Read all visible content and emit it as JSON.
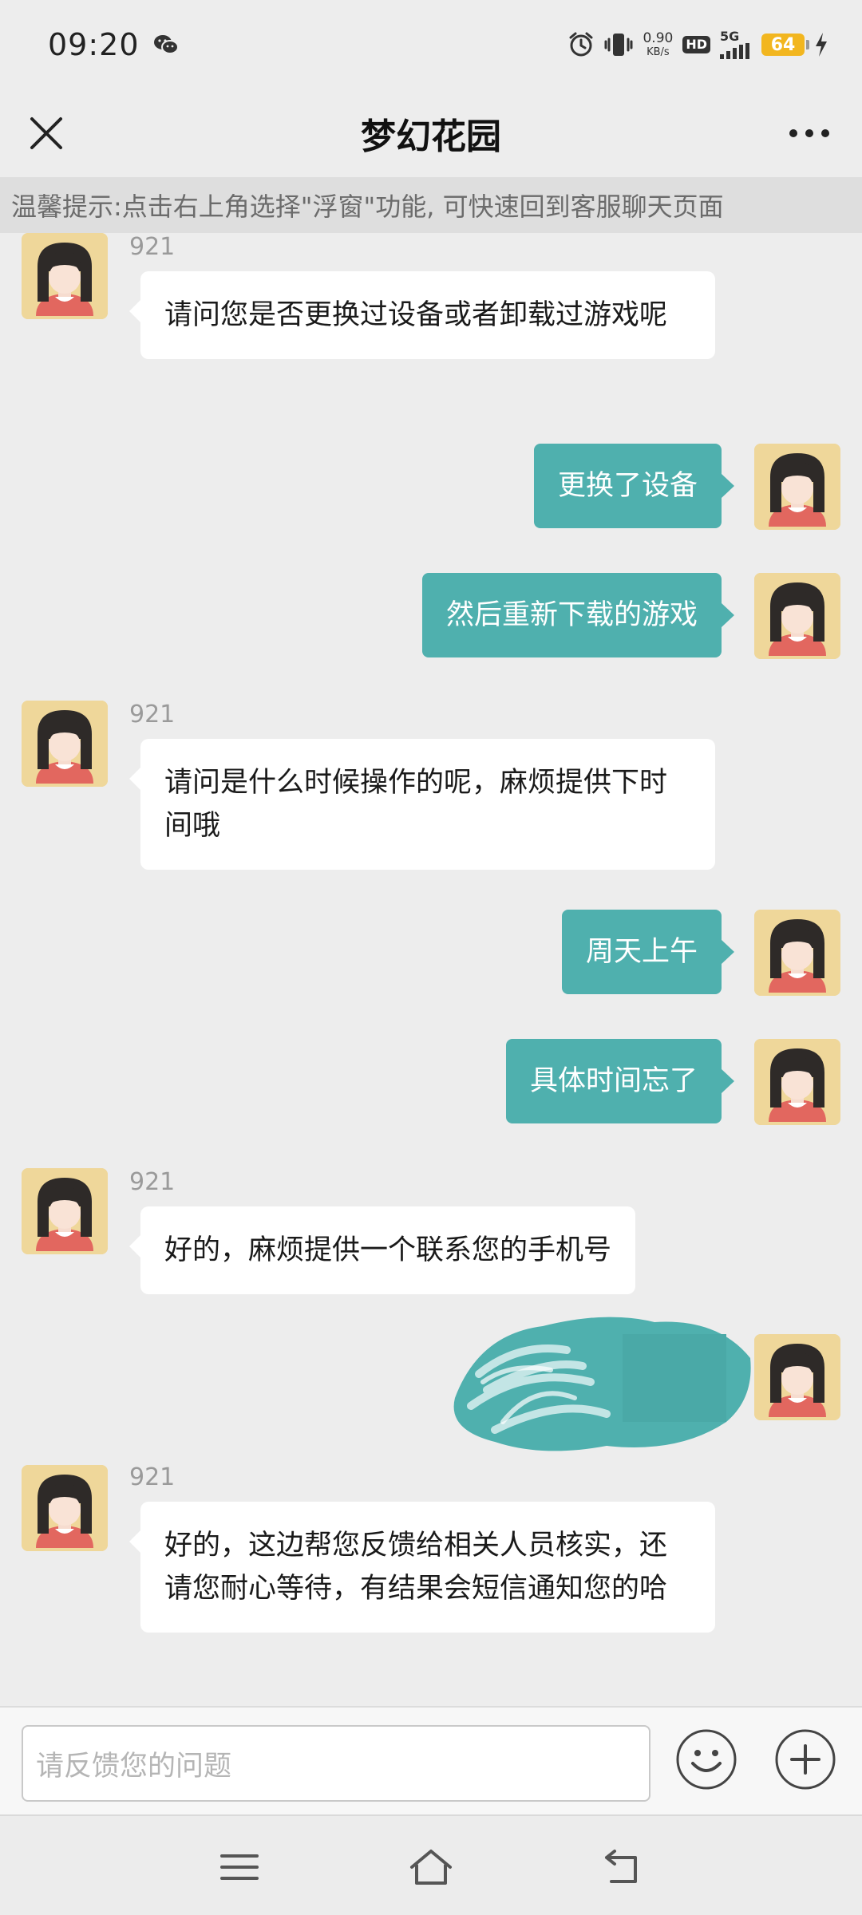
{
  "status_bar": {
    "time": "09:20",
    "net_speed_value": "0.90",
    "net_speed_unit": "KB/s",
    "hd": "HD",
    "network": "5G",
    "battery": "64"
  },
  "header": {
    "title": "梦幻花园"
  },
  "notice": {
    "text": "温馨提示:点击右上角选择\"浮窗\"功能, 可快速回到客服聊天页面"
  },
  "messages": [
    {
      "side": "left",
      "sender": "921",
      "text": "请问您是否更换过设备或者卸载过游戏呢"
    },
    {
      "side": "right",
      "text": "更换了设备"
    },
    {
      "side": "right",
      "text": "然后重新下载的游戏"
    },
    {
      "side": "left",
      "sender": "921",
      "text": "请问是什么时候操作的呢，麻烦提供下时间哦"
    },
    {
      "side": "right",
      "text": "周天上午"
    },
    {
      "side": "right",
      "text": "具体时间忘了"
    },
    {
      "side": "left",
      "sender": "921",
      "text": "好的，麻烦提供一个联系您的手机号"
    },
    {
      "side": "right",
      "text": "",
      "redacted": true
    },
    {
      "side": "left",
      "sender": "921",
      "text": "好的，这边帮您反馈给相关人员核实，还请您耐心等待，有结果会短信通知您的哈"
    }
  ],
  "input": {
    "placeholder": "请反馈您的问题"
  },
  "colors": {
    "accent": "#4fb0ae",
    "background": "#ededed",
    "avatar_bg": "#efd79a"
  }
}
